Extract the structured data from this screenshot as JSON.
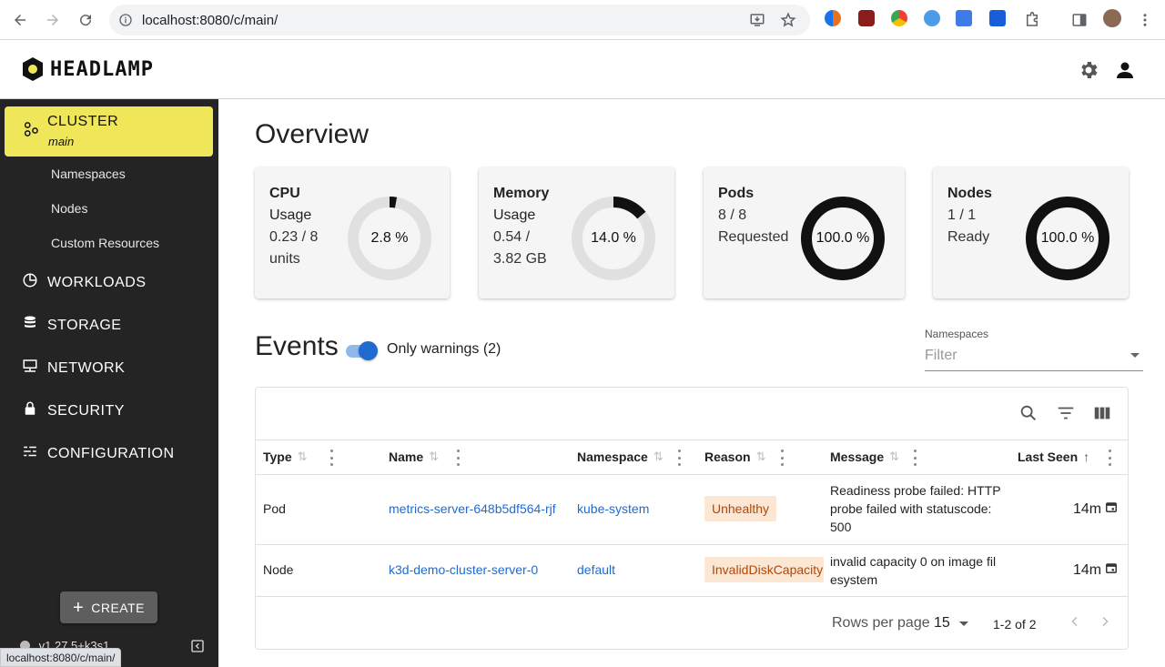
{
  "browser": {
    "url": "localhost:8080/c/main/",
    "status_url": "localhost:8080/c/main/"
  },
  "app": {
    "logo_text": "HEADLAMP"
  },
  "sidebar": {
    "cluster_label": "CLUSTER",
    "cluster_name": "main",
    "cluster_subitems": [
      "Namespaces",
      "Nodes",
      "Custom Resources"
    ],
    "items": [
      {
        "label": "WORKLOADS",
        "icon": "pie-chart-icon"
      },
      {
        "label": "STORAGE",
        "icon": "database-icon"
      },
      {
        "label": "NETWORK",
        "icon": "network-icon"
      },
      {
        "label": "SECURITY",
        "icon": "lock-icon"
      },
      {
        "label": "CONFIGURATION",
        "icon": "config-icon"
      }
    ],
    "create_label": "CREATE",
    "version": "v1.27.5+k3s1"
  },
  "overview": {
    "title": "Overview",
    "cards": [
      {
        "title_line1": "CPU",
        "title_line2": "Usage",
        "sub_line1": "0.23 / 8",
        "sub_line2": "units",
        "percent": 2.8,
        "percent_label": "2.8 %"
      },
      {
        "title_line1": "Memory",
        "title_line2": "Usage",
        "sub_line1": "0.54 /",
        "sub_line2": "3.82 GB",
        "percent": 14.0,
        "percent_label": "14.0 %"
      },
      {
        "title_line1": "Pods",
        "sub_line1": "8 / 8",
        "sub_line2": "Requested",
        "percent": 100.0,
        "percent_label": "100.0 %"
      },
      {
        "title_line1": "Nodes",
        "sub_line1": "1 / 1",
        "sub_line2": "Ready",
        "percent": 100.0,
        "percent_label": "100.0 %"
      }
    ]
  },
  "events": {
    "title": "Events",
    "toggle_label": "Only warnings (2)",
    "toggle_on": true,
    "namespaces_label": "Namespaces",
    "namespaces_placeholder": "Filter",
    "columns": [
      "Type",
      "Name",
      "Namespace",
      "Reason",
      "Message",
      "Last Seen"
    ],
    "rows": [
      {
        "type": "Pod",
        "name": "metrics-server-648b5df564-rjf",
        "namespace": "kube-system",
        "reason": "Unhealthy",
        "message_lines": [
          "Readiness probe failed: HTTP",
          "probe failed with statuscode:",
          "500"
        ],
        "last_seen": "14m"
      },
      {
        "type": "Node",
        "name": "k3d-demo-cluster-server-0",
        "namespace": "default",
        "reason": "InvalidDiskCapacity",
        "message_lines": [
          "invalid capacity 0 on image fil",
          "esystem"
        ],
        "last_seen": "14m"
      }
    ],
    "rows_per_page_label": "Rows per page",
    "rows_per_page": "15",
    "range_label": "1-2 of 2"
  },
  "colors": {
    "cluster_highlight": "#f0e65a",
    "sidebar_bg": "#242424",
    "link": "#1f6bd0",
    "reason_bg": "#fbe7d3",
    "reason_text": "#b1480b"
  }
}
